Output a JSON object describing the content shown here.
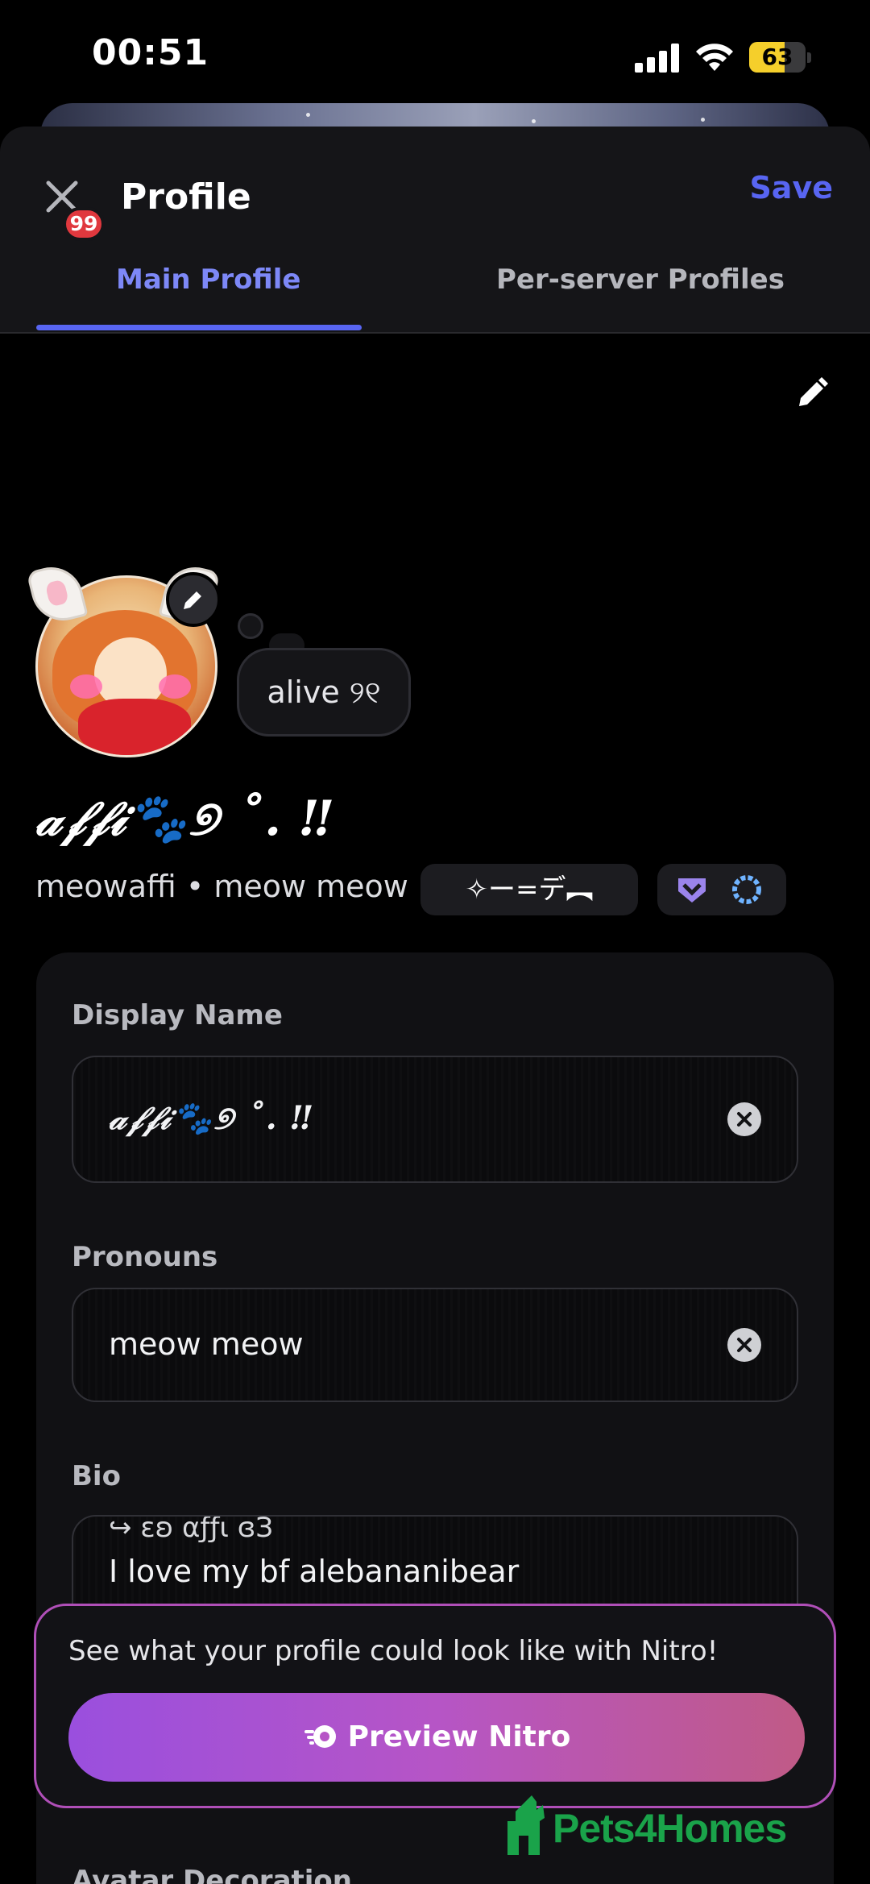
{
  "status_bar": {
    "time": "00:51",
    "battery": "63",
    "battery_level": 0.63
  },
  "header": {
    "title": "Profile",
    "save_label": "Save",
    "mention_count": "99",
    "tabs": [
      {
        "label": "Main Profile",
        "active": true
      },
      {
        "label": "Per-server Profiles",
        "active": false
      }
    ]
  },
  "profile": {
    "status_text": "alive ୨୧",
    "display_name": "𝒶𝒻𝒻𝒾🐾୭ ˚. ‼",
    "username_line": "meowaffi • meow meow",
    "tag_chip": "✧ー=デ︻"
  },
  "form": {
    "display_name": {
      "label": "Display Name",
      "value": "𝒶𝒻𝒻𝒾🐾୭ ˚. ‼"
    },
    "pronouns": {
      "label": "Pronouns",
      "value": "meow meow"
    },
    "bio": {
      "label": "Bio",
      "line1": "↪ εʚ αƒƒι ɞЗ",
      "line2": "I love my bf alebananibear"
    },
    "avatar_decoration": {
      "label": "Avatar Decoration"
    }
  },
  "nitro_promo": {
    "text": "See what your profile could look like with Nitro!",
    "button_label": "Preview Nitro"
  },
  "watermark": {
    "text": "Pets4Homes"
  },
  "colors": {
    "accent": "#5865f2",
    "tab_active": "#7d88f7",
    "nitro_border": "#b04fb8",
    "badge_red": "#e0383e",
    "watermark": "#1aa34a"
  }
}
